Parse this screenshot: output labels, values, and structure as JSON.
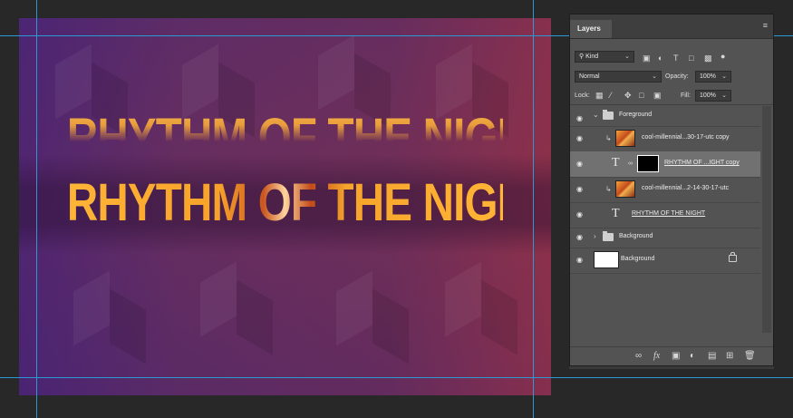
{
  "canvas": {
    "title_main": "RHYTHM OF THE NIGHT",
    "title_ghost": "RHYTHM OF THE NIGHT"
  },
  "panel": {
    "tab_label": "Layers",
    "filter_kind": "Kind",
    "blend_mode": "Normal",
    "opacity_label": "Opacity:",
    "opacity_value": "100%",
    "lock_label": "Lock:",
    "fill_label": "Fill:",
    "fill_value": "100%",
    "layers": [
      {
        "name": "Foreground",
        "type": "group",
        "expanded": true
      },
      {
        "name": "cool-millennial...30-17-utc copy",
        "type": "image",
        "clipped": true
      },
      {
        "name": "RHYTHM OF ...IGHT copy",
        "type": "text-masked",
        "selected": true
      },
      {
        "name": "cool-millennial...2-14-30-17-utc",
        "type": "image",
        "clipped": true
      },
      {
        "name": "RHYTHM OF THE NIGHT",
        "type": "text"
      },
      {
        "name": "Background",
        "type": "group",
        "expanded": false
      },
      {
        "name": "Background",
        "type": "background",
        "locked": true
      }
    ],
    "footer_icons": [
      "link-icon",
      "fx-icon",
      "mask-icon",
      "adjustment-icon",
      "folder-icon",
      "new-layer-icon",
      "trash-icon"
    ]
  },
  "colors": {
    "title_orange": "#ffb537",
    "guide": "#2b9ad2",
    "panel_bg": "#535353",
    "selected_row": "#717171"
  }
}
